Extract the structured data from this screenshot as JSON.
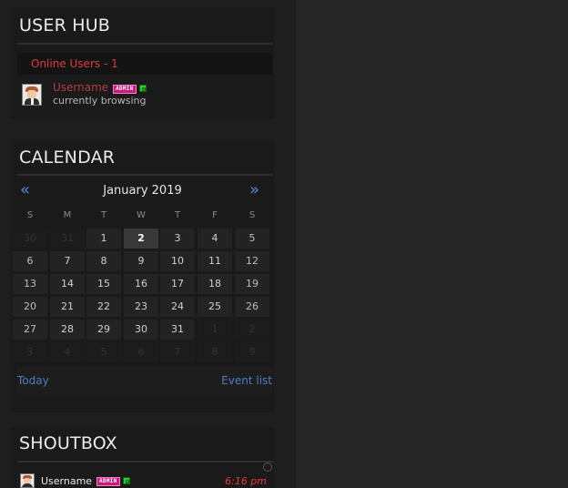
{
  "userhub": {
    "title": "USER HUB",
    "online_label": "Online Users - 1",
    "user": {
      "name": "Username",
      "badge": "ADMIN",
      "status": "currently browsing"
    }
  },
  "calendar": {
    "title": "CALENDAR",
    "prev_icon": "«",
    "next_icon": "»",
    "month": "January 2019",
    "weekdays": [
      "S",
      "M",
      "T",
      "W",
      "T",
      "F",
      "S"
    ],
    "weeks": [
      [
        "30",
        "31",
        "1",
        "2",
        "3",
        "4",
        "5"
      ],
      [
        "6",
        "7",
        "8",
        "9",
        "10",
        "11",
        "12"
      ],
      [
        "13",
        "14",
        "15",
        "16",
        "17",
        "18",
        "19"
      ],
      [
        "20",
        "21",
        "22",
        "23",
        "24",
        "25",
        "26"
      ],
      [
        "27",
        "28",
        "29",
        "30",
        "31",
        "1",
        "2"
      ],
      [
        "3",
        "4",
        "5",
        "6",
        "7",
        "8",
        "9"
      ]
    ],
    "today": "2",
    "today_label": "Today",
    "event_list_label": "Event list"
  },
  "shoutbox": {
    "title": "SHOUTBOX",
    "entries": [
      {
        "user": "Username",
        "badge": "ADMIN",
        "time": "6:16 pm"
      }
    ]
  },
  "colors": {
    "accent_red": "#e23b3b",
    "link_blue": "#4f7cc4",
    "admin_badge": "#c8197d",
    "online_green": "#2bd02b"
  }
}
